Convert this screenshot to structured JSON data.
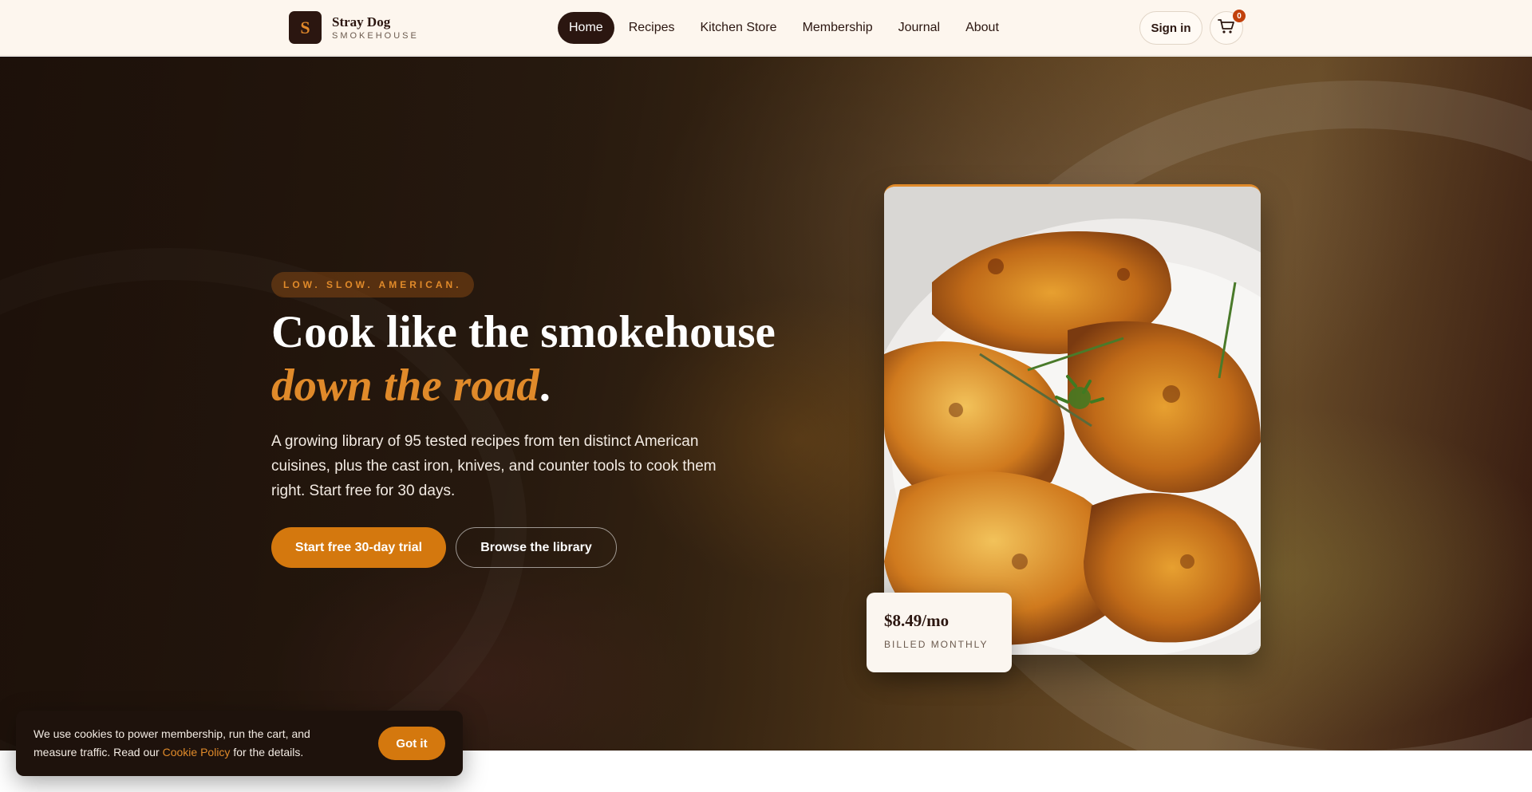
{
  "header": {
    "logo_letter": "S",
    "brand_name": "Stray Dog",
    "brand_sub": "SMOKEHOUSE",
    "nav": [
      {
        "label": "Home",
        "active": true
      },
      {
        "label": "Recipes"
      },
      {
        "label": "Kitchen Store"
      },
      {
        "label": "Membership"
      },
      {
        "label": "Journal"
      },
      {
        "label": "About"
      }
    ],
    "signin_label": "Sign in",
    "cart_count": "0",
    "cart_icon": "cart-icon"
  },
  "hero": {
    "eyebrow": "LOW. SLOW. AMERICAN.",
    "headline_line1": "Cook like the smokehouse",
    "headline_accent": "down the road",
    "headline_end": ".",
    "lede": "A growing library of 95 tested recipes from ten distinct American cuisines, plus the cast iron, knives, and counter tools to cook them right. Start free for 30 days.",
    "primary_cta": "Start free 30-day trial",
    "secondary_cta": "Browse the library"
  },
  "price_card": {
    "price": "$8.49/mo",
    "billed": "BILLED MONTHLY"
  },
  "cookie": {
    "text_before": "We use cookies to power membership, run the cart, and measure traffic. Read our ",
    "link_label": "Cookie Policy",
    "text_after": " for the details.",
    "button_label": "Got it"
  },
  "colors": {
    "accent": "#d4780e",
    "dark": "#2b1610",
    "header_bg": "#fdf6ee"
  }
}
